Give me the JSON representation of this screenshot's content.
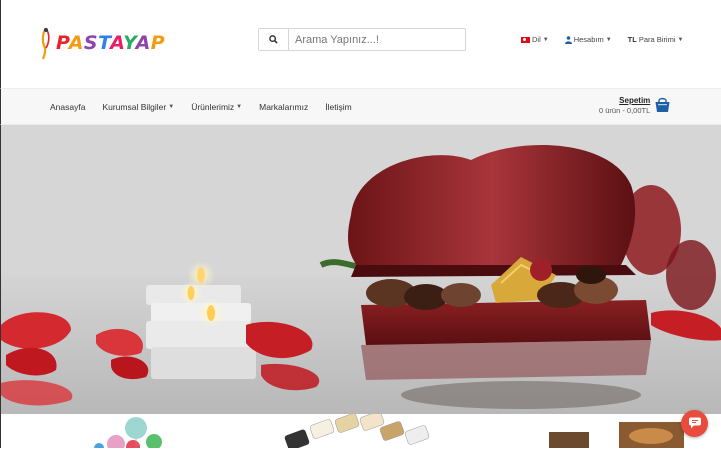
{
  "brand": {
    "name_letters": [
      "P",
      "A",
      "S",
      "T",
      "A",
      "Y",
      "A",
      "P"
    ]
  },
  "search": {
    "placeholder": "Arama Yapınız...!"
  },
  "top_links": {
    "language": "Dil",
    "account": "Hesabım",
    "currency_code": "TL",
    "currency_label": "Para Birimi"
  },
  "nav": {
    "items": [
      {
        "label": "Anasayfa",
        "dropdown": false
      },
      {
        "label": "Kurumsal Bilgiler",
        "dropdown": true
      },
      {
        "label": "Ürünlerimiz",
        "dropdown": true
      },
      {
        "label": "Markalarımız",
        "dropdown": false
      },
      {
        "label": "İletişim",
        "dropdown": false
      }
    ]
  },
  "cart": {
    "title": "Sepetim",
    "summary": "0 ürün - 0,00TL"
  },
  "colors": {
    "accent_red": "#e74c3c",
    "cart_blue": "#1f5fa8",
    "flag_red": "#e30a17"
  }
}
